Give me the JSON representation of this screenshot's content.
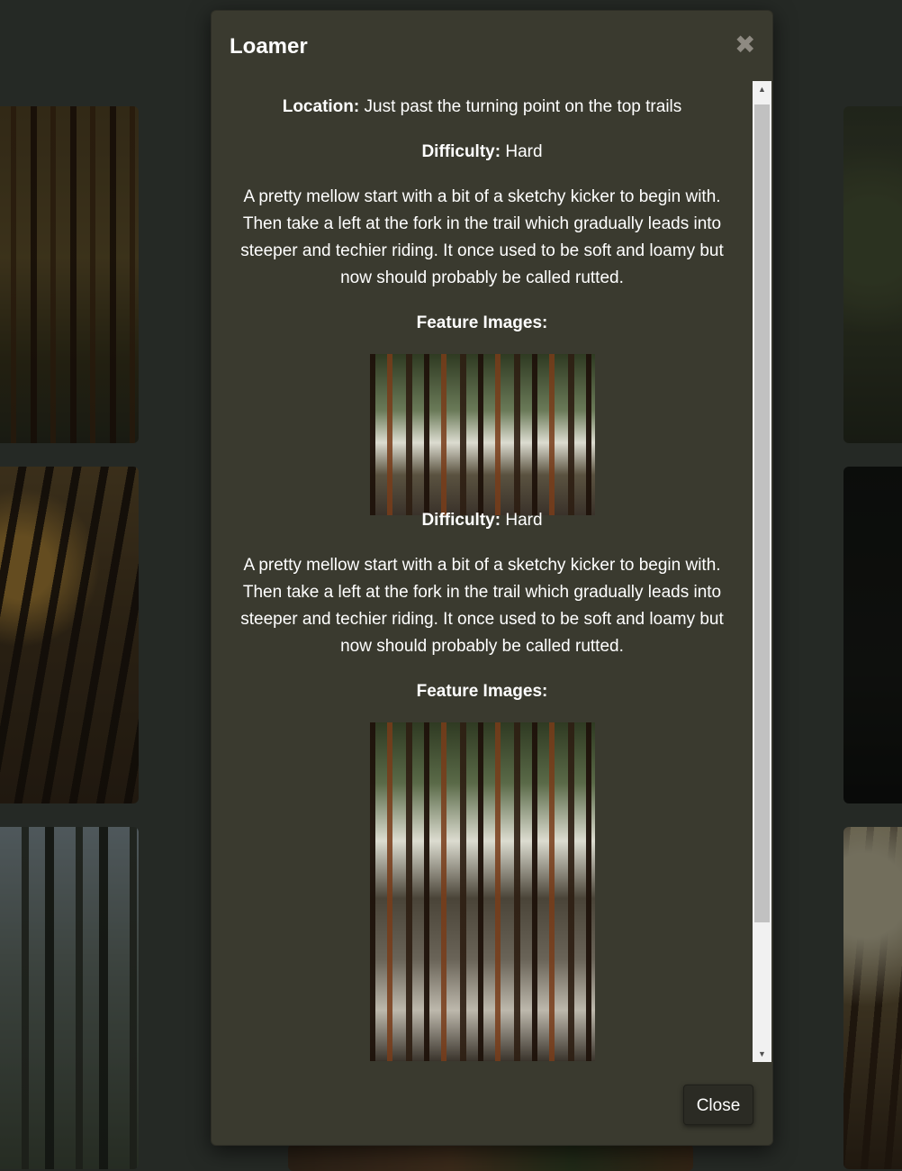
{
  "modal": {
    "title": "Loamer",
    "close_icon": "times-icon",
    "location_label": "Location:",
    "location_value": "Just past the turning point on the top trails",
    "difficulty_label": "Difficulty:",
    "difficulty_value": "Hard",
    "description": "A pretty mellow start with a bit of a sketchy kicker to begin with. Then take a left at the fork in the trail which gradually leads into steeper and techier riding. It once used to be soft and loamy but now should probably be called rutted.",
    "feature_images_label": "Feature Images:",
    "repeat": {
      "difficulty_label": "Difficulty:",
      "difficulty_value": "Hard",
      "description": "A pretty mellow start with a bit of a sketchy kicker to begin with. Then take a left at the fork in the trail which gradually leads into steeper and techier riding. It once used to be soft and loamy but now should probably be called rutted.",
      "feature_images_label": "Feature Images:"
    },
    "close_button_label": "Close"
  },
  "scrollbar": {
    "up_arrow_icon": "triangle-up-icon",
    "down_arrow_icon": "triangle-down-icon",
    "up_glyph": "▲",
    "down_glyph": "▼"
  },
  "close_glyph": "✖"
}
